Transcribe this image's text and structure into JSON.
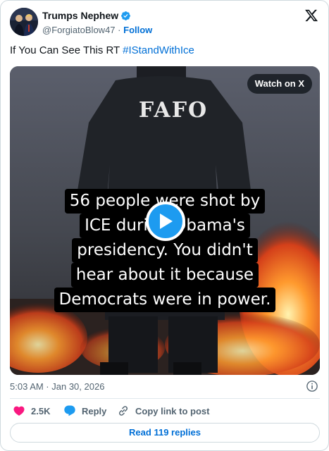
{
  "author": {
    "display_name": "Trumps Nephew",
    "handle": "@ForgiatoBlow47",
    "separator": "·",
    "follow_label": "Follow"
  },
  "tweet": {
    "text": "If You Can See This RT ",
    "hashtag": "#IStandWithIce"
  },
  "media": {
    "watch_label": "Watch on X",
    "shirt_text": "FAFO",
    "caption_lines": [
      "56 people were shot by",
      "ICE during Obama's",
      "presidency. You didn't",
      "hear about it because",
      "Democrats were in power."
    ]
  },
  "meta": {
    "timestamp": "5:03 AM · Jan 30, 2026"
  },
  "actions": {
    "like_count": "2.5K",
    "reply_label": "Reply",
    "copy_label": "Copy link to post"
  },
  "replies_button": "Read 119 replies",
  "colors": {
    "accent": "#1d9bf0",
    "link": "#006fd6",
    "like": "#f91880"
  }
}
